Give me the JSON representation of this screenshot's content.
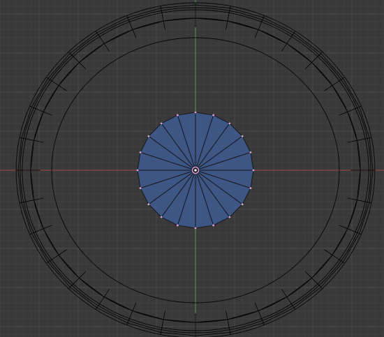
{
  "viewport": {
    "background": "#393939",
    "grid_minor_color": "#404040",
    "grid_major_color": "#4c4c4c",
    "x_axis_color": "#a3474a",
    "y_axis_color": "#4f9a4f",
    "wire_color": "#000000",
    "face_fill_color": "#3e5683",
    "face_edge_color": "#14161d",
    "selected_vertex_color": "#e4a0d4",
    "center_dot_color": "#ffffff"
  },
  "mesh": {
    "ring_segments": 32,
    "disc_segments": 20,
    "disc_selected": true
  }
}
